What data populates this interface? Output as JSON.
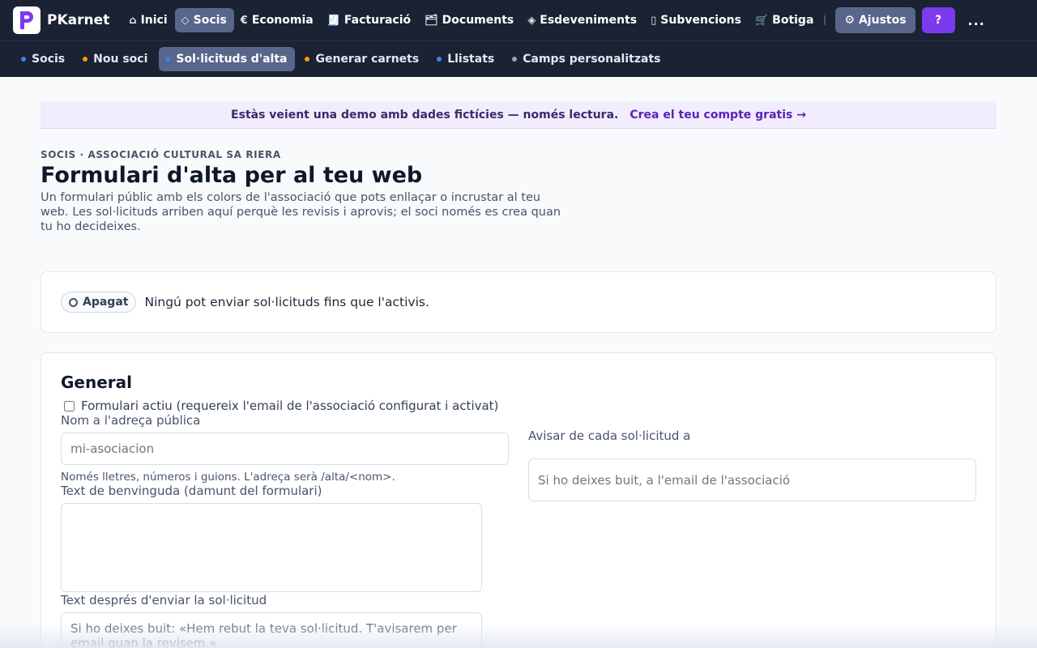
{
  "app": {
    "name": "PKarnet",
    "logo_icon": "pkarnet-logo"
  },
  "topnav": {
    "items": [
      {
        "label": "Inici",
        "icon": "home-icon",
        "glyph": "⌂",
        "active": false
      },
      {
        "label": "Socis",
        "icon": "diamond-icon",
        "glyph": "◇",
        "active": true
      },
      {
        "label": "Economia",
        "icon": "euro-icon",
        "glyph": "€",
        "active": false
      },
      {
        "label": "Facturació",
        "icon": "receipt-icon",
        "glyph": "🧾",
        "active": false
      },
      {
        "label": "Documents",
        "icon": "folder-icon",
        "glyph": "🗂",
        "active": false
      },
      {
        "label": "Esdeveniments",
        "icon": "event-diamond-icon",
        "glyph": "◈",
        "active": false
      },
      {
        "label": "Subvencions",
        "icon": "columns-icon",
        "glyph": "▯",
        "active": false
      },
      {
        "label": "Botiga",
        "icon": "cart-icon",
        "glyph": "🛒",
        "active": false
      }
    ],
    "settings_label": "Ajustos",
    "settings_glyph": "⚙",
    "help_label": "?",
    "more_label": "..."
  },
  "subnav": {
    "items": [
      {
        "label": "Socis",
        "dot_color": "#3b82f6",
        "active": false
      },
      {
        "label": "Nou soci",
        "dot_color": "#f59e0b",
        "active": false
      },
      {
        "label": "Sol·licituds d'alta",
        "dot_color": "#3b82f6",
        "active": true
      },
      {
        "label": "Generar carnets",
        "dot_color": "#f59e0b",
        "active": false
      },
      {
        "label": "Llistats",
        "dot_color": "#3b82f6",
        "active": false
      },
      {
        "label": "Camps personalitzats",
        "dot_color": "#94a3b8",
        "active": false
      }
    ]
  },
  "banner": {
    "text": "Estàs veient una demo amb dades fictícies — només lectura.",
    "link": "Crea el teu compte gratis →"
  },
  "page": {
    "eyebrow": "SOCIS · ASSOCIACIÓ CULTURAL SA RIERA",
    "title": "Formulari d'alta per al teu web",
    "description": "Un formulari públic amb els colors de l'associació que pots enllaçar o incrustar al teu web. Les sol·licituds arriben aquí perquè les revisis i aprovis; el soci només es crea quan tu ho decideixes."
  },
  "status": {
    "badge": "Apagat",
    "text": "Ningú pot enviar sol·licituds fins que l'activis."
  },
  "form": {
    "section_title": "General",
    "active_checkbox_label": "Formulari actiu (requereix l'email de l'associació configurat i activat)",
    "active_checked": false,
    "public_name_label": "Nom a l'adreça pública",
    "public_name_placeholder": "mi-asociacion",
    "public_name_help": "Només lletres, números i guions. L'adreça serà /alta/<nom>.",
    "notify_label": "Avisar de cada sol·licitud a",
    "notify_placeholder": "Si ho deixes buit, a l'email de l'associació",
    "welcome_label": "Text de benvinguda (damunt del formulari)",
    "welcome_value": "",
    "after_label": "Text després d'enviar la sol·licitud",
    "after_placeholder": "Si ho deixes buit: «Hem rebut la teva sol·licitud. T'avisarem per email quan la revisem.»"
  },
  "colors": {
    "nav_bg": "#1a2233",
    "nav_active": "#58668c",
    "help_button": "#7c3aed",
    "banner_bg": "#f1edfd",
    "banner_link": "#5b21b6"
  }
}
